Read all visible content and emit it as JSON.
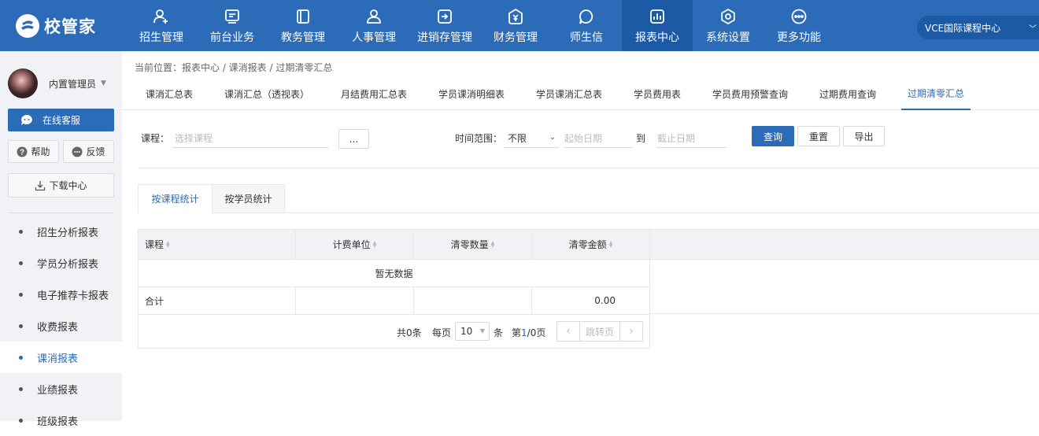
{
  "brand": {
    "name": "校管家"
  },
  "nav": {
    "items": [
      {
        "label": "招生管理",
        "icon": "person-plus-icon"
      },
      {
        "label": "前台业务",
        "icon": "monitor-icon"
      },
      {
        "label": "教务管理",
        "icon": "book-icon"
      },
      {
        "label": "人事管理",
        "icon": "person-icon"
      },
      {
        "label": "进销存管理",
        "icon": "inventory-icon"
      },
      {
        "label": "财务管理",
        "icon": "money-bag-icon"
      },
      {
        "label": "师生信",
        "icon": "chat-icon"
      },
      {
        "label": "报表中心",
        "icon": "report-icon",
        "active": true
      },
      {
        "label": "系统设置",
        "icon": "settings-icon"
      },
      {
        "label": "更多功能",
        "icon": "more-icon"
      }
    ],
    "org_selector": "VCE国际课程中心"
  },
  "sidebar": {
    "user_name": "内置管理员",
    "online_service": "在线客服",
    "help": "帮助",
    "feedback": "反馈",
    "download_center": "下载中心",
    "menu": [
      {
        "label": "招生分析报表"
      },
      {
        "label": "学员分析报表"
      },
      {
        "label": "电子推荐卡报表"
      },
      {
        "label": "收费报表"
      },
      {
        "label": "课消报表",
        "active": true
      },
      {
        "label": "业绩报表"
      },
      {
        "label": "班级报表"
      }
    ]
  },
  "breadcrumb": "当前位置：报表中心 / 课消报表 / 过期清零汇总",
  "report_tabs": [
    {
      "label": "课消汇总表"
    },
    {
      "label": "课消汇总（透视表）"
    },
    {
      "label": "月结费用汇总表"
    },
    {
      "label": "学员课消明细表"
    },
    {
      "label": "学员课消汇总表"
    },
    {
      "label": "学员费用表"
    },
    {
      "label": "学员费用预警查询"
    },
    {
      "label": "过期费用查询"
    },
    {
      "label": "过期清零汇总",
      "active": true
    }
  ],
  "filters": {
    "course_label": "课程：",
    "course_placeholder": "选择课程",
    "more_button": "...",
    "time_label": "时间范围：",
    "time_value": "不限",
    "start_placeholder": "起始日期",
    "to_label": "到",
    "end_placeholder": "截止日期",
    "query": "查询",
    "reset": "重置",
    "export": "导出"
  },
  "stat_tabs": [
    {
      "label": "按课程统计",
      "active": true
    },
    {
      "label": "按学员统计"
    }
  ],
  "table": {
    "columns": [
      "课程",
      "计费单位",
      "清零数量",
      "清零金额"
    ],
    "empty_text": "暂无数据",
    "summary": {
      "label": "合计",
      "amount": "0.00"
    }
  },
  "pager": {
    "total": "共0条",
    "per_page_label": "每页",
    "page_size": "10",
    "unit": "条",
    "page_prefix": "第",
    "current": "1",
    "page_suffix": "/0页",
    "jump": "跳转页"
  },
  "colors": {
    "primary": "#2b6bb8",
    "nav_active": "#1d5aa6",
    "sidebar_bg": "#f0f2f5"
  }
}
